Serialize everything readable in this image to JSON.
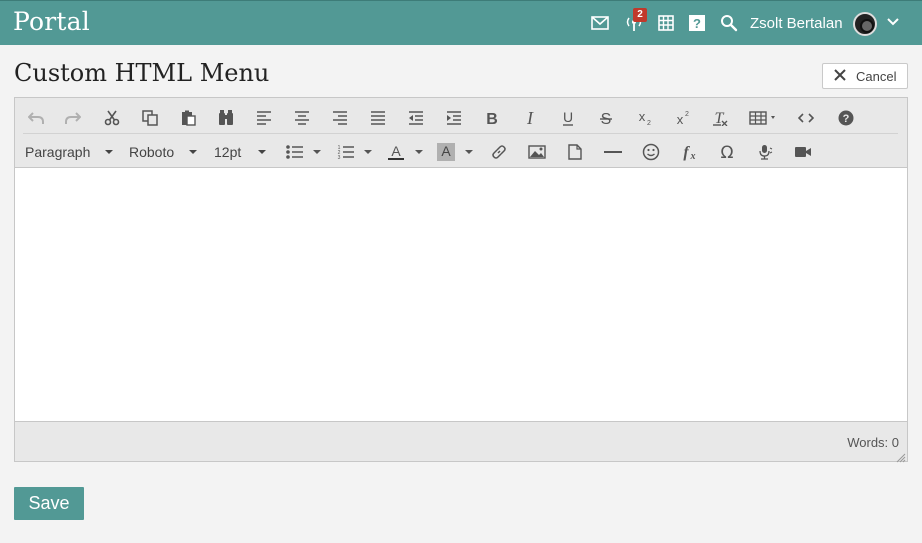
{
  "topbar": {
    "brand": "Portal",
    "notification_count": "2",
    "user_name": "Zsolt Bertalan",
    "icons": [
      "mail-icon",
      "broadcast-icon",
      "calendar-grid-icon",
      "help-icon",
      "search-icon",
      "chevron-down-icon"
    ]
  },
  "page": {
    "title": "Custom HTML Menu",
    "cancel_label": "Cancel",
    "save_label": "Save"
  },
  "editor": {
    "format_block": "Paragraph",
    "font_family": "Roboto",
    "font_size": "12pt",
    "word_count": "Words: 0",
    "toolbar_row1": [
      "undo",
      "redo",
      "cut",
      "copy",
      "paste",
      "find-replace",
      "align-left",
      "align-center",
      "align-right",
      "justify",
      "outdent",
      "indent",
      "bold",
      "italic",
      "underline",
      "strikethrough",
      "subscript",
      "superscript",
      "clear-formatting",
      "table",
      "source-code",
      "help"
    ],
    "toolbar_row2": [
      "format-block",
      "font-family",
      "font-size",
      "bullet-list",
      "numbered-list",
      "text-color",
      "background-color",
      "link",
      "image",
      "page",
      "horizontal-rule",
      "emoticon",
      "formula",
      "special-character",
      "speech",
      "video"
    ]
  },
  "colors": {
    "accent": "#529995",
    "toolbar_bg": "#e8e8e8",
    "page_bg": "#f3f3f3",
    "badge": "#c0392b"
  }
}
